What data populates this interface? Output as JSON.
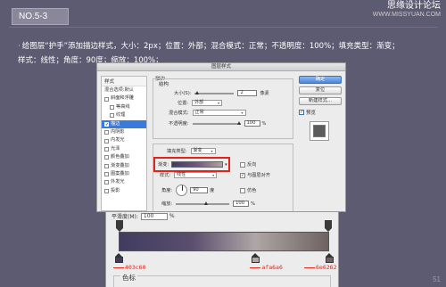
{
  "header": {
    "step": "NO.5-3",
    "watermark_line1": "思缘设计论坛",
    "watermark_line2": "WWW.MISSYUAN.COM"
  },
  "instruction": {
    "bullet": "·",
    "line1": "给图层“护手”添加描边样式，大小：2px；位置：外部；混合模式：正常；不透明度：100%；填充类型：渐变；",
    "line2": "样式：线性；角度：90度；缩放：100%；"
  },
  "page_number": "51",
  "dialog": {
    "title": "图层样式",
    "sidebar": {
      "header": "样式",
      "items": [
        {
          "label": "混合选项:默认",
          "checked": false,
          "indent": false,
          "active": false,
          "has_checkbox": false
        },
        {
          "label": "斜面和浮雕",
          "checked": false,
          "indent": false,
          "active": false,
          "has_checkbox": true
        },
        {
          "label": "等高线",
          "checked": false,
          "indent": true,
          "active": false,
          "has_checkbox": true
        },
        {
          "label": "纹理",
          "checked": false,
          "indent": true,
          "active": false,
          "has_checkbox": true
        },
        {
          "label": "描边",
          "checked": true,
          "indent": false,
          "active": true,
          "has_checkbox": true
        },
        {
          "label": "内阴影",
          "checked": false,
          "indent": false,
          "active": false,
          "has_checkbox": true
        },
        {
          "label": "内发光",
          "checked": false,
          "indent": false,
          "active": false,
          "has_checkbox": true
        },
        {
          "label": "光泽",
          "checked": false,
          "indent": false,
          "active": false,
          "has_checkbox": true
        },
        {
          "label": "颜色叠加",
          "checked": false,
          "indent": false,
          "active": false,
          "has_checkbox": true
        },
        {
          "label": "渐变叠加",
          "checked": false,
          "indent": false,
          "active": false,
          "has_checkbox": true
        },
        {
          "label": "图案叠加",
          "checked": false,
          "indent": false,
          "active": false,
          "has_checkbox": true
        },
        {
          "label": "外发光",
          "checked": false,
          "indent": false,
          "active": false,
          "has_checkbox": true
        },
        {
          "label": "投影",
          "checked": false,
          "indent": false,
          "active": false,
          "has_checkbox": true
        }
      ]
    },
    "stroke": {
      "section_label": "描边",
      "structure_label": "结构",
      "size_label": "大小(S):",
      "size_value": "2",
      "size_unit": "像素",
      "position_label": "位置:",
      "position_value": "外部",
      "blend_label": "混合模式:",
      "blend_value": "正常",
      "opacity_label": "不透明度:",
      "opacity_value": "100",
      "opacity_unit": "%",
      "fill_type_label": "填充类型:",
      "fill_type_value": "渐变",
      "gradient_label": "渐变:",
      "reverse_label": "反向",
      "style_label": "样式:",
      "style_value": "线性",
      "align_label": "与图层对齐",
      "angle_label": "角度:",
      "angle_value": "90",
      "angle_unit": "度",
      "dither_label": "仿色",
      "scale_label": "缩放:",
      "scale_value": "100",
      "scale_unit": "%"
    },
    "buttons": {
      "ok": "确定",
      "reset": "复位",
      "new_style": "新建样式...",
      "preview": "预览"
    }
  },
  "gradient_editor": {
    "smoothness_label": "平滑度(M):",
    "smoothness_value": "100",
    "smoothness_unit": "%",
    "stops": [
      {
        "label": "403c60",
        "color": "#403c60",
        "location_pct": 0
      },
      {
        "label": "afa6a6",
        "color": "#afa6a6",
        "location_pct": 65
      },
      {
        "label": "6e6262",
        "color": "#6e6262",
        "location_pct": 100
      }
    ],
    "color_section_label": "色标"
  },
  "colors": {
    "background": "#5d5b71",
    "accent_red": "#e2231a",
    "selection_blue": "#3b7ad9"
  }
}
